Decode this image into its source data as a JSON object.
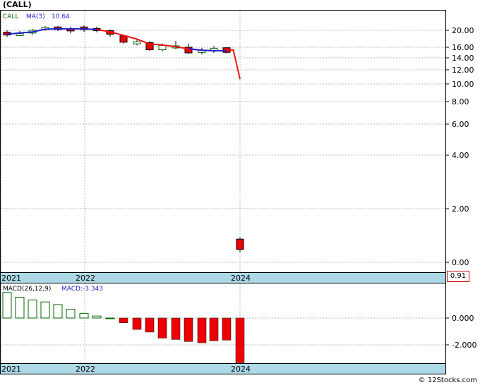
{
  "header": {
    "title": "(CALL)"
  },
  "price_panel": {
    "legend_ticker": "CALL",
    "legend_ma": "MA(3)",
    "legend_ma_value": "10.64",
    "last_price_label": "0.91"
  },
  "macd_panel": {
    "legend_name": "MACD(26,12,9)",
    "legend_value_label": "MACD:-3.343"
  },
  "footer": {
    "credit": "© 12Stocks.com"
  },
  "colors": {
    "up_candle_outline": "#006600",
    "down_candle_fill": "#ee0000",
    "ma_line_blue": "#2222cc",
    "ma_line_red": "#ee1111",
    "axis_band": "#add8e6",
    "macd_pos": "#006600",
    "macd_neg": "#ee0000"
  },
  "chart_data": [
    {
      "type": "candlestick",
      "title": "(CALL)",
      "scale": "log",
      "y_ticks": [
        "20.00",
        "16.00",
        "14.00",
        "12.00",
        "10.00",
        "8.00",
        "6.00",
        "4.00",
        "2.00",
        "0.00"
      ],
      "x_ticks": [
        "2021",
        "2022",
        "2024"
      ],
      "candles": [
        {
          "open": 18.8,
          "close": 19.5,
          "high": 20.0,
          "low": 18.3,
          "dir": "down"
        },
        {
          "open": 19.0,
          "close": 19.2,
          "high": 19.8,
          "low": 18.6,
          "dir": "up"
        },
        {
          "open": 19.3,
          "close": 20.0,
          "high": 20.4,
          "low": 18.9,
          "dir": "up"
        },
        {
          "open": 20.2,
          "close": 20.8,
          "high": 21.2,
          "low": 19.9,
          "dir": "up"
        },
        {
          "open": 20.9,
          "close": 20.2,
          "high": 21.2,
          "low": 19.8,
          "dir": "down"
        },
        {
          "open": 20.4,
          "close": 20.2,
          "high": 21.0,
          "low": 19.2,
          "dir": "down"
        },
        {
          "open": 20.2,
          "close": 20.9,
          "high": 21.4,
          "low": 19.6,
          "dir": "down"
        },
        {
          "open": 20.5,
          "close": 20.3,
          "high": 21.0,
          "low": 19.5,
          "dir": "down"
        },
        {
          "open": 19.9,
          "close": 19.0,
          "high": 20.2,
          "low": 18.4,
          "dir": "down"
        },
        {
          "open": 18.6,
          "close": 17.1,
          "high": 18.8,
          "low": 16.8,
          "dir": "down"
        },
        {
          "open": 16.8,
          "close": 17.2,
          "high": 17.8,
          "low": 16.4,
          "dir": "up"
        },
        {
          "open": 17.0,
          "close": 15.5,
          "high": 17.3,
          "low": 15.3,
          "dir": "down"
        },
        {
          "open": 15.5,
          "close": 16.4,
          "high": 16.8,
          "low": 15.2,
          "dir": "up"
        },
        {
          "open": 16.3,
          "close": 16.0,
          "high": 17.4,
          "low": 15.6,
          "dir": "up"
        },
        {
          "open": 16.0,
          "close": 14.9,
          "high": 16.8,
          "low": 14.7,
          "dir": "down"
        },
        {
          "open": 15.1,
          "close": 15.4,
          "high": 15.9,
          "low": 14.6,
          "dir": "up"
        },
        {
          "open": 15.4,
          "close": 15.8,
          "high": 16.2,
          "low": 14.9,
          "dir": "up"
        },
        {
          "open": 15.9,
          "close": 15.0,
          "high": 16.0,
          "low": 14.8,
          "dir": "down"
        },
        {
          "open": 0.7,
          "close": 0.91,
          "high": 0.95,
          "low": 0.65,
          "dir": "down"
        }
      ],
      "ma_line": [
        {
          "idx": 0,
          "value": 19.0
        },
        {
          "idx": 1,
          "value": 19.3
        },
        {
          "idx": 2,
          "value": 19.6
        },
        {
          "idx": 3,
          "value": 20.3
        },
        {
          "idx": 4,
          "value": 20.4
        },
        {
          "idx": 5,
          "value": 20.4
        },
        {
          "idx": 6,
          "value": 20.4
        },
        {
          "idx": 7,
          "value": 20.2
        },
        {
          "idx": 8,
          "value": 19.6
        },
        {
          "idx": 9,
          "value": 18.7
        },
        {
          "idx": 10,
          "value": 17.8
        },
        {
          "idx": 11,
          "value": 16.7
        },
        {
          "idx": 12,
          "value": 16.5
        },
        {
          "idx": 13,
          "value": 16.1
        },
        {
          "idx": 14,
          "value": 15.7
        },
        {
          "idx": 15,
          "value": 15.4
        },
        {
          "idx": 16,
          "value": 15.3
        },
        {
          "idx": 17,
          "value": 15.3
        },
        {
          "idx": 17.5,
          "value": 15.5
        },
        {
          "idx": 18,
          "value": 10.64
        }
      ]
    },
    {
      "type": "bar",
      "title": "MACD(26,12,9)",
      "y_ticks": [
        "0.000",
        "-2.000"
      ],
      "x_ticks": [
        "2021",
        "2022",
        "2024"
      ],
      "values": [
        1.9,
        1.55,
        1.35,
        1.2,
        1.0,
        0.65,
        0.35,
        0.15,
        0.0,
        -0.35,
        -0.85,
        -1.05,
        -1.5,
        -1.6,
        -1.75,
        -1.85,
        -1.7,
        -1.65,
        -3.343
      ]
    }
  ]
}
